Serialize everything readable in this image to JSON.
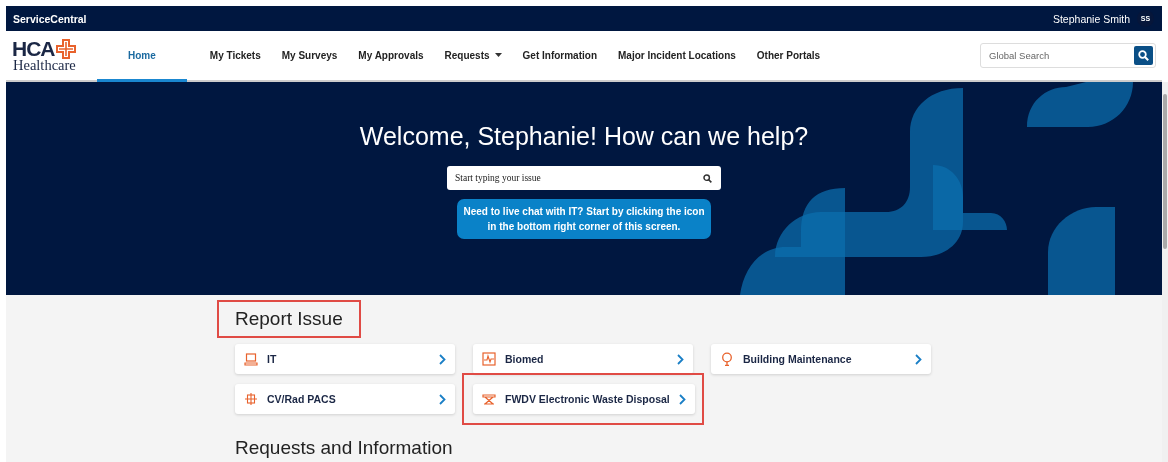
{
  "top_bar": {
    "brand": "ServiceCentral",
    "user_name": "Stephanie Smith",
    "avatar_initials": "SS"
  },
  "nav": {
    "logo": {
      "name": "HCA",
      "subtitle": "Healthcare"
    },
    "items": [
      {
        "label": "Home",
        "selected": true,
        "dropdown": false
      },
      {
        "label": "My Tickets",
        "selected": false,
        "dropdown": false
      },
      {
        "label": "My Surveys",
        "selected": false,
        "dropdown": false
      },
      {
        "label": "My Approvals",
        "selected": false,
        "dropdown": false
      },
      {
        "label": "Requests",
        "selected": false,
        "dropdown": true
      },
      {
        "label": "Get Information",
        "selected": false,
        "dropdown": false
      },
      {
        "label": "Major Incident Locations",
        "selected": false,
        "dropdown": false
      },
      {
        "label": "Other Portals",
        "selected": false,
        "dropdown": false
      }
    ],
    "search": {
      "placeholder": "Global Search"
    }
  },
  "hero": {
    "title": "Welcome, Stephanie! How can we help?",
    "search": {
      "placeholder": "Start typing your issue"
    },
    "notice": "Need to live chat with IT? Start by clicking the icon in the bottom right corner of this screen."
  },
  "sections": [
    {
      "title": "Report Issue",
      "highlighted": true,
      "cards": [
        {
          "label": "IT",
          "highlighted": false
        },
        {
          "label": "Biomed",
          "highlighted": false
        },
        {
          "label": "Building Maintenance",
          "highlighted": false
        },
        {
          "label": "CV/Rad PACS",
          "highlighted": false
        },
        {
          "label": "FWDV Electronic Waste Disposal",
          "highlighted": true
        }
      ]
    },
    {
      "title": "Requests and Information",
      "highlighted": false
    }
  ]
}
